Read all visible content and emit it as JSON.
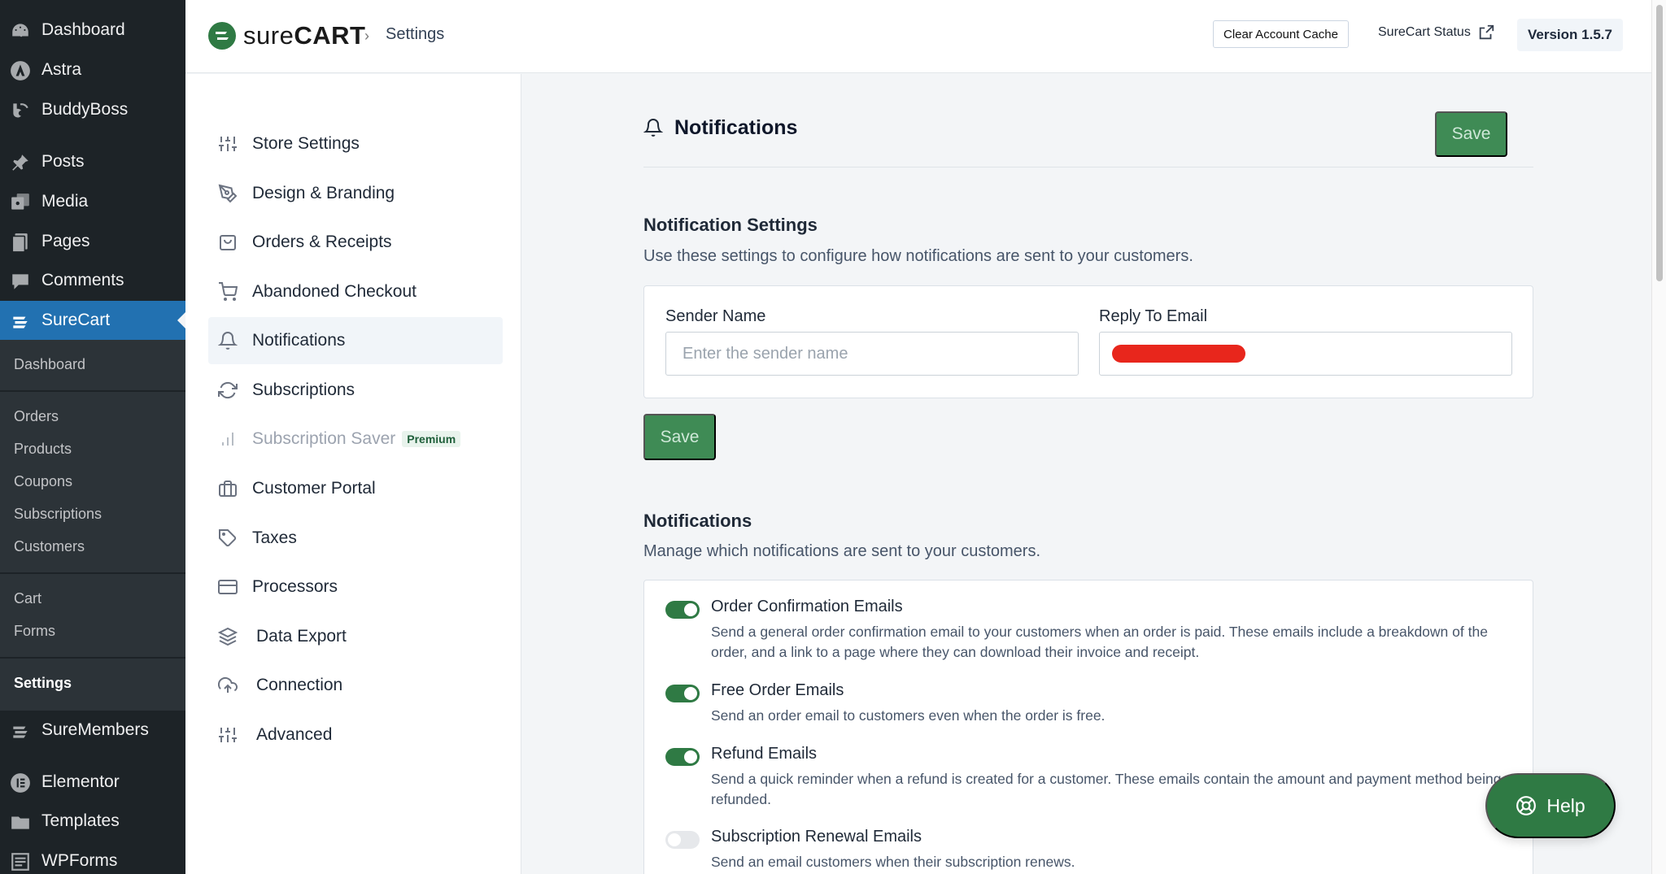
{
  "wp_sidebar": {
    "top_items": [
      {
        "label": "Dashboard",
        "icon": "dashboard-icon"
      },
      {
        "label": "Astra",
        "icon": "astra-icon"
      },
      {
        "label": "BuddyBoss",
        "icon": "buddyboss-icon"
      },
      {
        "label": "Posts",
        "icon": "pin-icon"
      },
      {
        "label": "Media",
        "icon": "media-icon"
      },
      {
        "label": "Pages",
        "icon": "pages-icon"
      },
      {
        "label": "Comments",
        "icon": "comment-icon"
      },
      {
        "label": "SureCart",
        "icon": "surecart-icon"
      }
    ],
    "submenu": [
      "Dashboard",
      "Orders",
      "Products",
      "Coupons",
      "Subscriptions",
      "Customers",
      "Cart",
      "Forms",
      "Settings"
    ],
    "bottom_items": [
      {
        "label": "SureMembers",
        "icon": "suremembers-icon"
      },
      {
        "label": "Elementor",
        "icon": "elementor-icon"
      },
      {
        "label": "Templates",
        "icon": "folder-icon"
      },
      {
        "label": "WPForms",
        "icon": "forms-icon"
      }
    ]
  },
  "header": {
    "brand_light": "sure",
    "brand_bold": "CART",
    "breadcrumb": "Settings",
    "clear_cache": "Clear Account Cache",
    "status_link": "SureCart Status",
    "version": "Version 1.5.7"
  },
  "settings_nav": [
    {
      "label": "Store Settings",
      "icon": "sliders-icon"
    },
    {
      "label": "Design & Branding",
      "icon": "pen-icon"
    },
    {
      "label": "Orders & Receipts",
      "icon": "bag-icon"
    },
    {
      "label": "Abandoned Checkout",
      "icon": "cart-icon"
    },
    {
      "label": "Notifications",
      "icon": "bell-icon"
    },
    {
      "label": "Subscriptions",
      "icon": "refresh-icon"
    },
    {
      "label": "Subscription Saver",
      "icon": "bar-chart-icon",
      "badge": "Premium"
    },
    {
      "label": "Customer Portal",
      "icon": "briefcase-icon"
    },
    {
      "label": "Taxes",
      "icon": "tag-icon"
    },
    {
      "label": "Processors",
      "icon": "credit-card-icon"
    },
    {
      "label": "Data Export",
      "icon": "layers-icon"
    },
    {
      "label": "Connection",
      "icon": "cloud-upload-icon"
    },
    {
      "label": "Advanced",
      "icon": "sliders-icon"
    }
  ],
  "main": {
    "title": "Notifications",
    "save_label": "Save",
    "settings_section": {
      "title": "Notification Settings",
      "description": "Use these settings to configure how notifications are sent to your customers.",
      "sender_name_label": "Sender Name",
      "sender_name_placeholder": "Enter the sender name",
      "reply_to_label": "Reply To Email"
    },
    "notifications_section": {
      "title": "Notifications",
      "description": "Manage which notifications are sent to your customers.",
      "items": [
        {
          "title": "Order Confirmation Emails",
          "description": "Send a general order confirmation email to your customers when an order is paid. These emails include a breakdown of the order, and a link to a page where they can download their invoice and receipt.",
          "enabled": true
        },
        {
          "title": "Free Order Emails",
          "description": "Send an order email to customers even when the order is free.",
          "enabled": true
        },
        {
          "title": "Refund Emails",
          "description": "Send a quick reminder when a refund is created for a customer. These emails contain the amount and payment method being refunded.",
          "enabled": true
        },
        {
          "title": "Subscription Renewal Emails",
          "description": "Send an email customers when their subscription renews.",
          "enabled": false
        }
      ]
    }
  },
  "help": {
    "label": "Help"
  },
  "colors": {
    "wp_admin": "#1d2327",
    "wp_active": "#2271b1",
    "accent_green": "#3f8b55",
    "toggle_on": "#2f7a44",
    "redaction": "#e8261c"
  }
}
